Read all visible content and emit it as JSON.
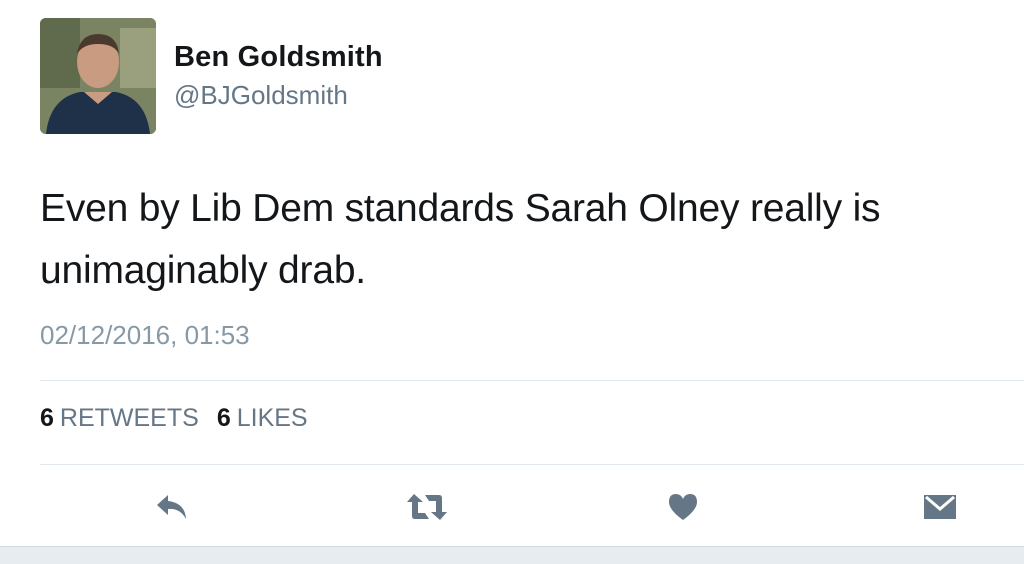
{
  "user": {
    "display_name": "Ben Goldsmith",
    "handle": "@BJGoldsmith"
  },
  "tweet": {
    "text": "Even by Lib Dem standards Sarah Olney really is unimaginably drab.",
    "timestamp": "02/12/2016, 01:53"
  },
  "stats": {
    "retweets_count": "6",
    "retweets_label": "RETWEETS",
    "likes_count": "6",
    "likes_label": "LIKES"
  },
  "actions": {
    "reply_icon": "reply-icon",
    "retweet_icon": "retweet-icon",
    "like_icon": "heart-icon",
    "dm_icon": "envelope-icon"
  },
  "colors": {
    "icon": "#657786",
    "secondary_text": "#657786",
    "timestamp": "#8899a6",
    "primary_text": "#14171a",
    "divider": "#e1e8ed"
  }
}
